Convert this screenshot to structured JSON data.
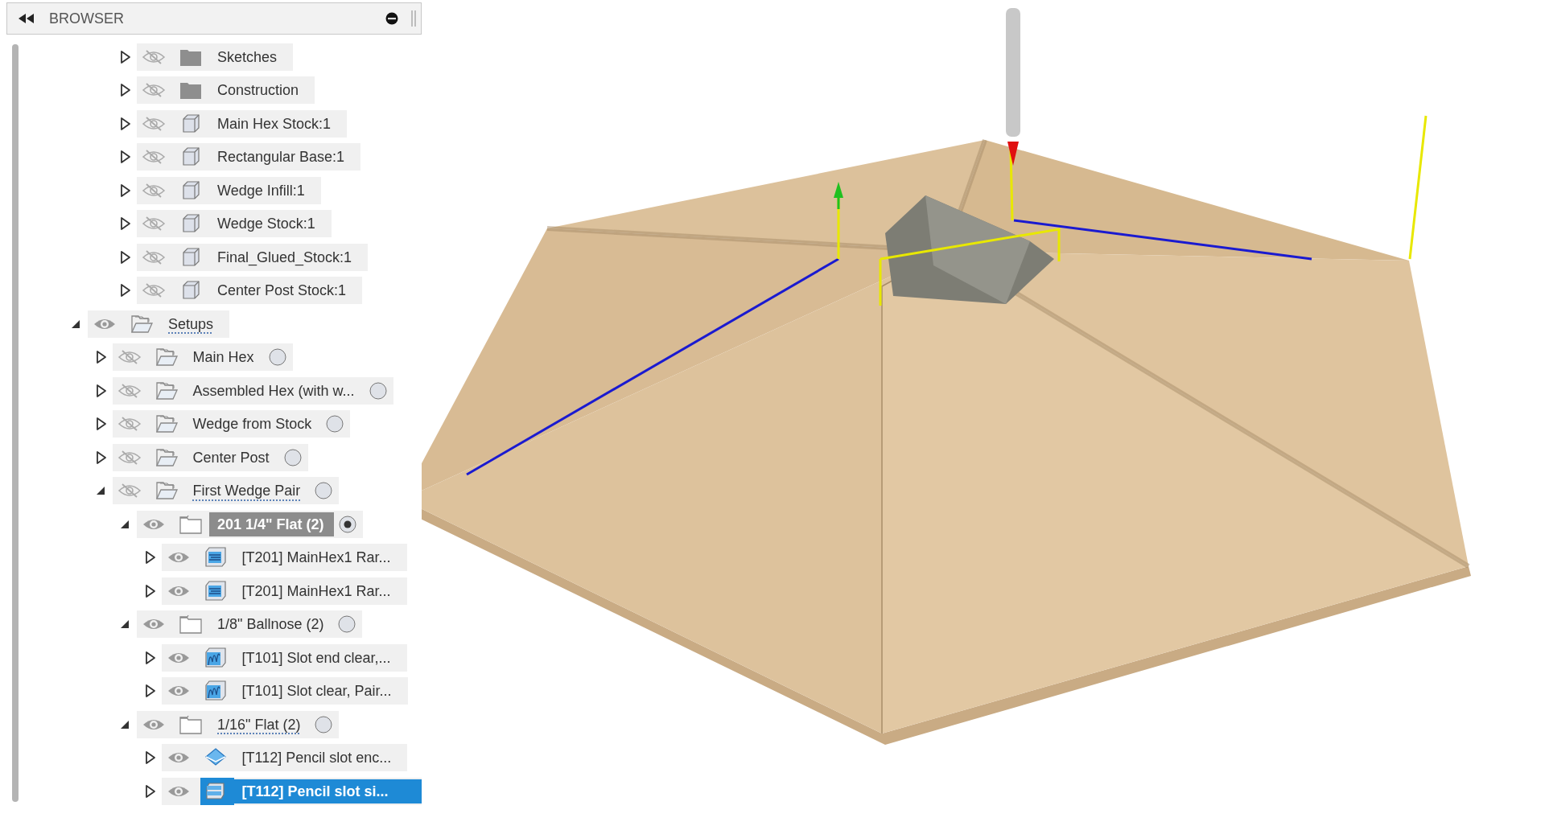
{
  "browser": {
    "title": "BROWSER",
    "components": [
      {
        "label": "Sketches",
        "kind": "folder",
        "expanded": false,
        "visible": false,
        "selected": false,
        "warning": false
      },
      {
        "label": "Construction",
        "kind": "folder",
        "expanded": false,
        "visible": false,
        "selected": false,
        "warning": false
      },
      {
        "label": "Main Hex Stock:1",
        "kind": "body",
        "expanded": false,
        "visible": false,
        "selected": false,
        "warning": false
      },
      {
        "label": "Rectangular Base:1",
        "kind": "body",
        "expanded": false,
        "visible": false,
        "selected": false,
        "warning": false
      },
      {
        "label": "Wedge Infill:1",
        "kind": "body",
        "expanded": false,
        "visible": false,
        "selected": false,
        "warning": false
      },
      {
        "label": "Wedge Stock:1",
        "kind": "body",
        "expanded": false,
        "visible": false,
        "selected": false,
        "warning": false
      },
      {
        "label": "Final_Glued_Stock:1",
        "kind": "body",
        "expanded": false,
        "visible": false,
        "selected": false,
        "warning": false
      },
      {
        "label": "Center Post Stock:1",
        "kind": "body",
        "expanded": false,
        "visible": false,
        "selected": false,
        "warning": false
      }
    ],
    "setup_tree": [
      {
        "label": "Setups",
        "kind": "setup-folder",
        "expanded": true,
        "visible": true,
        "selected": false,
        "warning": true,
        "children": [
          {
            "label": "Main Hex",
            "kind": "setup",
            "expanded": false,
            "visible": false,
            "selected": false,
            "warning": false,
            "active": false
          },
          {
            "label": "Assembled Hex (with w...",
            "kind": "setup",
            "expanded": false,
            "visible": false,
            "selected": false,
            "warning": false,
            "active": false
          },
          {
            "label": "Wedge from Stock",
            "kind": "setup",
            "expanded": false,
            "visible": false,
            "selected": false,
            "warning": false,
            "active": false
          },
          {
            "label": "Center Post",
            "kind": "setup",
            "expanded": false,
            "visible": false,
            "selected": false,
            "warning": false,
            "active": false
          },
          {
            "label": "First Wedge Pair",
            "kind": "setup",
            "expanded": true,
            "visible": false,
            "selected": false,
            "warning": true,
            "active": false,
            "children": [
              {
                "label": "201 1/4\" Flat (2)",
                "kind": "tool",
                "expanded": true,
                "visible": true,
                "selected": false,
                "warning": false,
                "active": true,
                "children": [
                  {
                    "label": "[T201] MainHex1 Rar...",
                    "kind": "adaptive",
                    "expanded": false,
                    "visible": true,
                    "selected": false,
                    "warning": false
                  },
                  {
                    "label": "[T201] MainHex1 Rar...",
                    "kind": "adaptive",
                    "expanded": false,
                    "visible": true,
                    "selected": false,
                    "warning": false
                  }
                ]
              },
              {
                "label": "1/8\" Ballnose (2)",
                "kind": "tool",
                "expanded": true,
                "visible": true,
                "selected": false,
                "warning": false,
                "active": false,
                "children": [
                  {
                    "label": "[T101] Slot end clear,...",
                    "kind": "contour",
                    "expanded": false,
                    "visible": true,
                    "selected": false,
                    "warning": false
                  },
                  {
                    "label": "[T101] Slot clear, Pair...",
                    "kind": "contour",
                    "expanded": false,
                    "visible": true,
                    "selected": false,
                    "warning": false
                  }
                ]
              },
              {
                "label": "1/16\" Flat (2)",
                "kind": "tool",
                "expanded": true,
                "visible": true,
                "selected": false,
                "warning": true,
                "active": false,
                "children": [
                  {
                    "label": "[T112] Pencil slot enc...",
                    "kind": "pencil",
                    "expanded": false,
                    "visible": true,
                    "selected": false,
                    "warning": false
                  },
                  {
                    "label": "[T112] Pencil slot si...",
                    "kind": "flat",
                    "expanded": false,
                    "visible": true,
                    "selected": true,
                    "warning": false
                  }
                ]
              }
            ]
          }
        ]
      }
    ]
  }
}
